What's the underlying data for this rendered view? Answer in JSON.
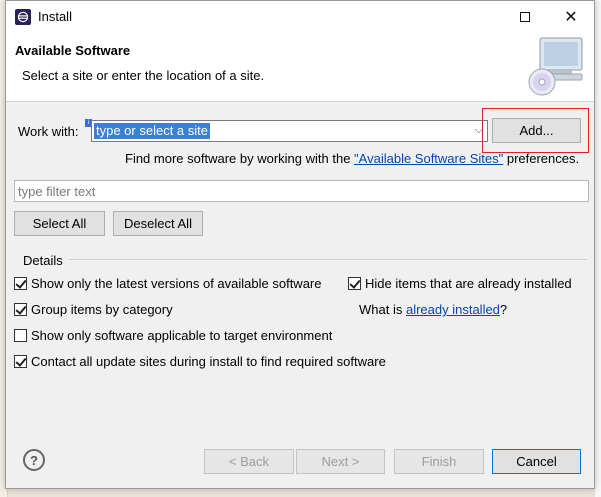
{
  "window": {
    "title": "Install"
  },
  "header": {
    "title": "Available Software",
    "subtitle": "Select a site or enter the location of a site."
  },
  "work_with": {
    "label": "Work with:",
    "value": "type or select a site",
    "add_label": "Add..."
  },
  "find_more": {
    "prefix": "Find more software by working with the ",
    "link": "\"Available Software Sites\"",
    "suffix": " preferences."
  },
  "filter": {
    "placeholder": "type filter text"
  },
  "selection": {
    "select_all": "Select All",
    "deselect_all": "Deselect All"
  },
  "details": {
    "label": "Details",
    "options": [
      {
        "label": "Show only the latest versions of available software",
        "checked": true
      },
      {
        "label": "Group items by category",
        "checked": true
      },
      {
        "label": "Show only software applicable to target environment",
        "checked": false
      },
      {
        "label": "Contact all update sites during install to find required software",
        "checked": true
      },
      {
        "label": "Hide items that are already installed",
        "checked": true
      }
    ],
    "what_is_prefix": "What is ",
    "what_is_link": "already installed",
    "what_is_suffix": "?"
  },
  "footer": {
    "help": "?",
    "back": "< Back",
    "next": "Next >",
    "finish": "Finish",
    "cancel": "Cancel"
  },
  "icons": {
    "app": "eclipse-icon",
    "header": "computer-cd-icon",
    "help": "help-icon"
  },
  "colors": {
    "selection": "#3b7fd6",
    "link": "#0645ad",
    "highlight": "#e02020"
  }
}
